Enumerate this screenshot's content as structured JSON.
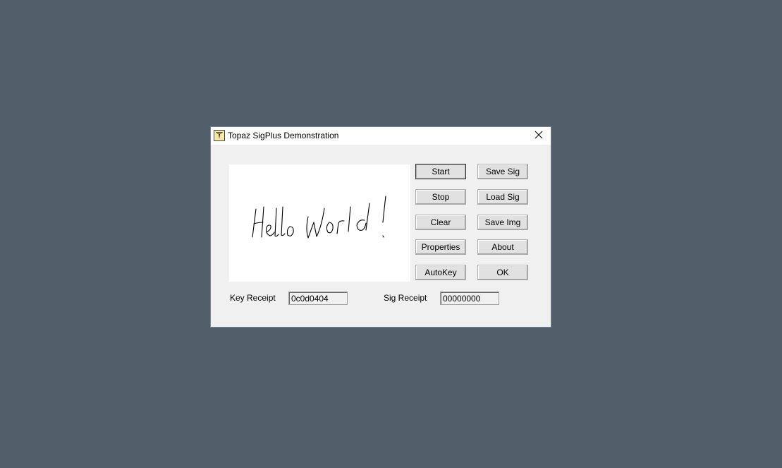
{
  "window": {
    "title": "Topaz SigPlus Demonstration",
    "icon": "topaz-logo-icon",
    "close_icon": "close-icon"
  },
  "signature_pad": {
    "ink": "Hello World!"
  },
  "buttons": {
    "start": "Start",
    "stop": "Stop",
    "clear": "Clear",
    "properties": "Properties",
    "autokey": "AutoKey",
    "save_sig": "Save Sig",
    "load_sig": "Load Sig",
    "save_img": "Save Img",
    "about": "About",
    "ok": "OK"
  },
  "receipts": {
    "key_label": "Key Receipt",
    "key_value": "0c0d0404",
    "sig_label": "Sig Receipt",
    "sig_value": "00000000"
  },
  "colors": {
    "desktop": "#535e6b",
    "window_bg": "#f0f0f0",
    "titlebar_bg": "#ffffff"
  }
}
